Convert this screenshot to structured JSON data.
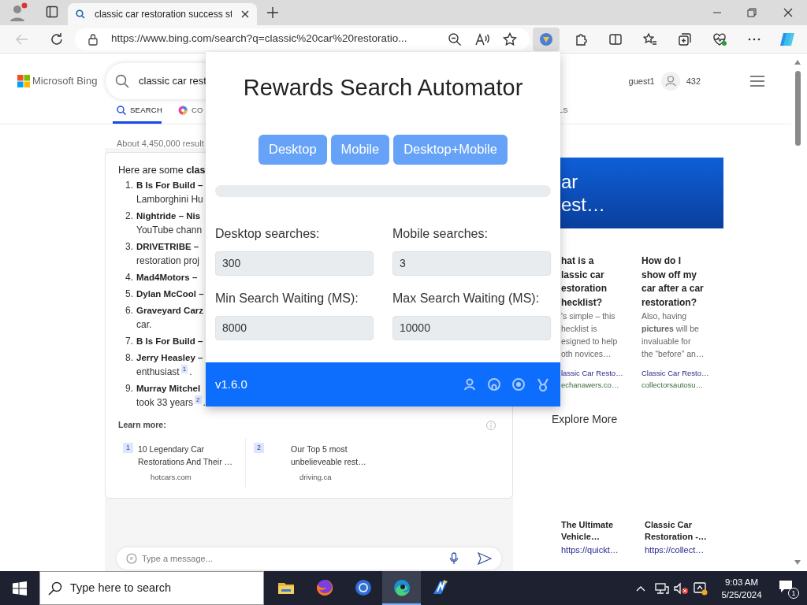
{
  "browser": {
    "tab": {
      "title": "classic car restoration success st",
      "selected": true
    },
    "back_disabled": true,
    "url": "https://www.bing.com/search?q=classic%20car%20restoratio...",
    "extension_active": true
  },
  "bing": {
    "logo_text": "Microsoft Bing",
    "query": "classic car rest",
    "user": "guest1",
    "points": "432",
    "tabs": [
      {
        "label": "SEARCH",
        "selected": true
      },
      {
        "label": "CO",
        "selected": false
      },
      {
        "label": "LS",
        "selected": false
      }
    ],
    "result_count": "About 4,450,000 result",
    "answer": {
      "intro": "Here are some **clas**",
      "items": [
        {
          "number": "1.",
          "title": "B Is For Build –",
          "text": "Lamborghini Hu"
        },
        {
          "number": "2.",
          "title": "Nightride – Nis",
          "text": "YouTube chann"
        },
        {
          "number": "3.",
          "title": "DRIVETRIBE –",
          "text": "restoration proj"
        },
        {
          "number": "4.",
          "title": "Mad4Motors –"
        },
        {
          "number": "5.",
          "title": "Dylan McCool –"
        },
        {
          "number": "6.",
          "title": "Graveyard Carz",
          "text": "car."
        },
        {
          "number": "7.",
          "title": "B Is For Build –"
        },
        {
          "number": "8.",
          "title": "Jerry Heasley –",
          "text": "enthusiast",
          "cite": "1",
          "end": "."
        },
        {
          "number": "9.",
          "title": "Murray Mitchel",
          "text": "took 33 years",
          "cite": "2",
          "end": "."
        }
      ],
      "learn_more": "Learn more:",
      "sources": [
        {
          "index": "1",
          "lines": [
            "10 Legendary Car",
            "Restorations And Their …"
          ],
          "domain": "hotcars.com"
        },
        {
          "index": "2",
          "lines": [
            "Our Top 5 most",
            "unbelieveable rest…"
          ],
          "domain": "driving.ca"
        }
      ]
    },
    "chat_placeholder": "Type a message...",
    "banner_lines": [
      "ar",
      "est…"
    ],
    "qa_cards": [
      {
        "question_lines": [
          "hat is a",
          "lassic car",
          "estoration",
          "hecklist?"
        ],
        "snippet_lines": [
          "'s simple – this",
          "hecklist is",
          "esigned to help",
          "oth novices…"
        ],
        "source": "lassic Car Resto…",
        "domain": "echanawers.co…"
      },
      {
        "question_lines": [
          "How do I",
          "show off my",
          "car after a car",
          "restoration?"
        ],
        "snippet_lines": [
          "Also, having",
          "**pictures** will be",
          "invaluable for",
          "the “before” an…"
        ],
        "source": "Classic Car Resto…",
        "domain": "collectorsautosu…"
      }
    ],
    "explore_title": "Explore More",
    "explore_cards": [
      {
        "title_lines": [
          "The Ultimate",
          "Vehicle…"
        ],
        "url": "https://quickt…"
      },
      {
        "title_lines": [
          "Classic Car",
          "Restoration -…"
        ],
        "url": "https://collect…"
      }
    ]
  },
  "popup": {
    "title": "Rewards Search Automator",
    "modes": [
      {
        "label": "Desktop"
      },
      {
        "label": "Mobile"
      },
      {
        "label": "Desktop+Mobile"
      }
    ],
    "progress": {
      "level": 0
    },
    "fields": [
      {
        "label": "Desktop searches:",
        "value": "300"
      },
      {
        "label": "Mobile searches:",
        "value": "3"
      },
      {
        "label": "Min Search Waiting (MS):",
        "value": "8000"
      },
      {
        "label": "Max Search Waiting (MS):",
        "value": "10000"
      }
    ],
    "version": "v1.6.0"
  },
  "taskbar": {
    "search_placeholder": "Type here to search",
    "apps": [
      {
        "kind": "folder",
        "selected": false
      },
      {
        "kind": "fox",
        "selected": false
      },
      {
        "kind": "ring",
        "selected": false
      },
      {
        "kind": "swirl",
        "selected": true
      },
      {
        "kind": "bolt",
        "selected": false
      }
    ],
    "time": "9:03 AM",
    "date": "5/25/2024",
    "notifications": "1"
  }
}
